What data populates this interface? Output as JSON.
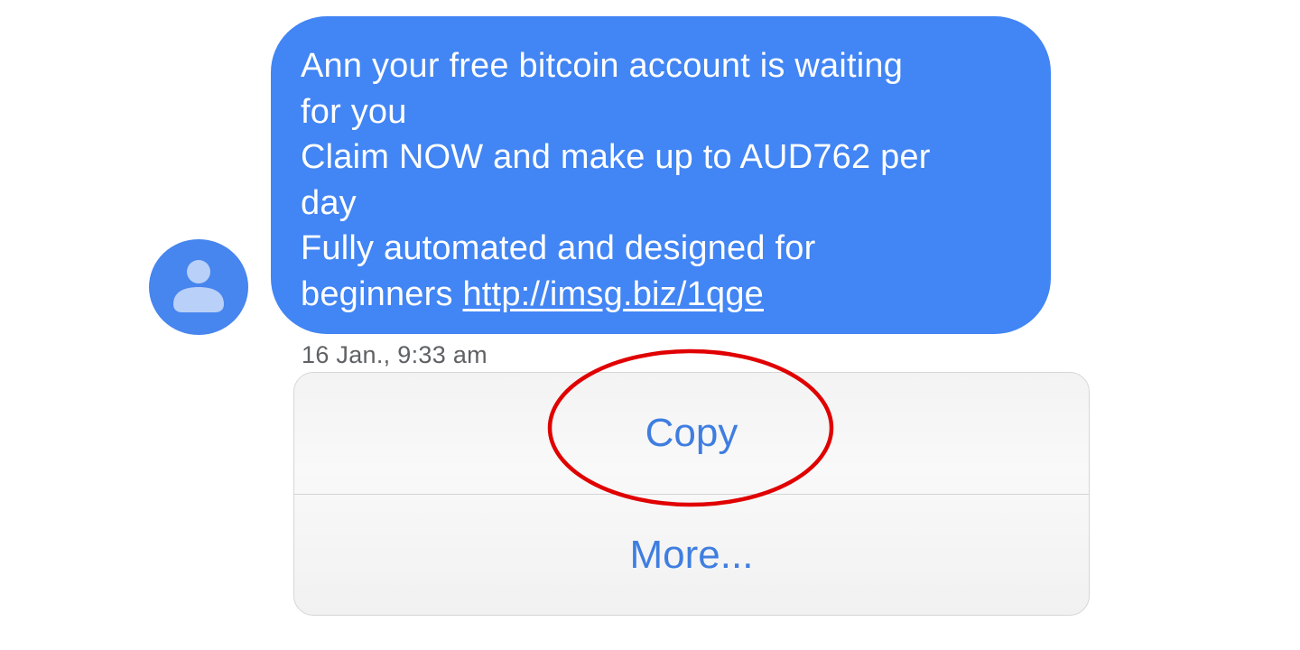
{
  "message": {
    "lines": [
      "Ann your free bitcoin account is waiting",
      "for you",
      "Claim NOW and make up to AUD762 per",
      "day",
      "Fully automated and designed for"
    ],
    "last_line_prefix": "beginners ",
    "link": "http://imsg.biz/1qge",
    "timestamp": "16 Jan., 9:33 am"
  },
  "context_menu": {
    "copy_label": "Copy",
    "more_label": "More..."
  },
  "colors": {
    "bubble": "#4285f4",
    "avatar": "#4785ef",
    "action_text": "#3f7ee0",
    "highlight_circle": "#e00000"
  },
  "icons": {
    "avatar": "person-icon"
  }
}
